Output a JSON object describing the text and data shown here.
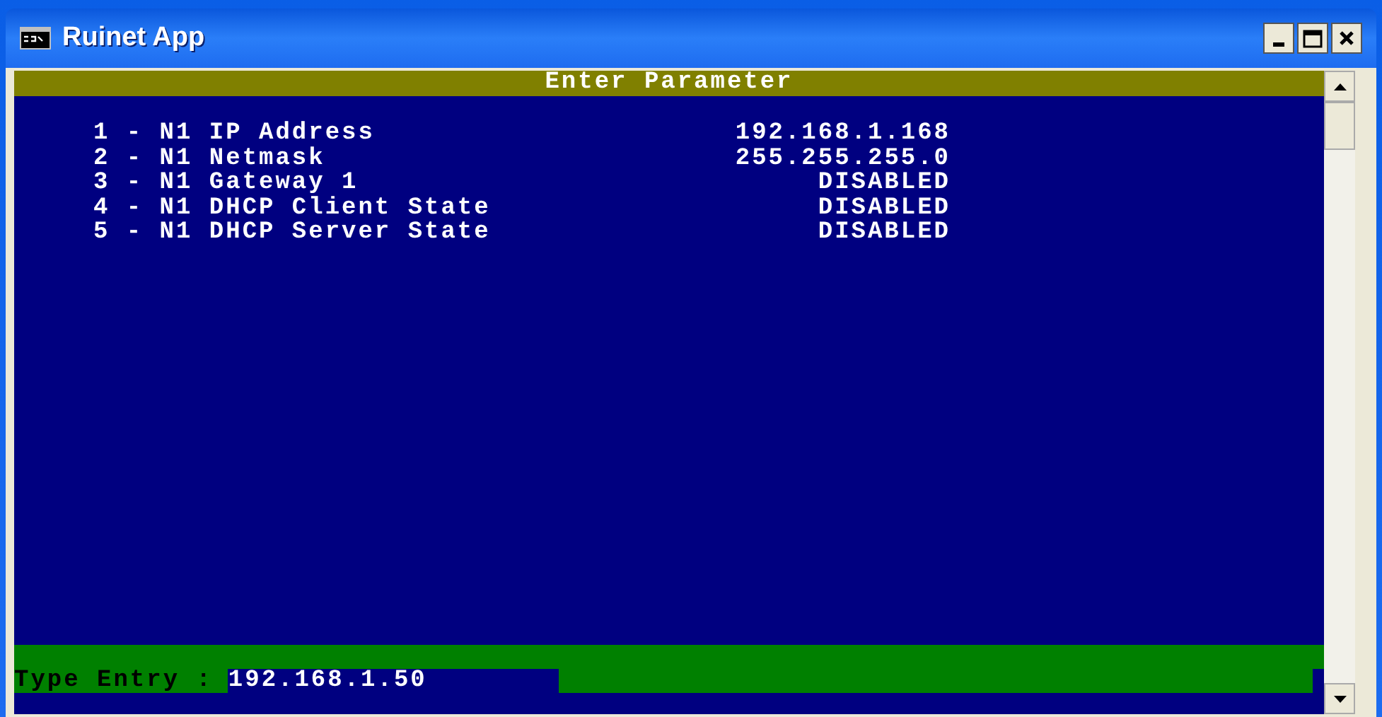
{
  "window": {
    "title": "Ruinet App"
  },
  "header": "Enter Parameter",
  "parameters": [
    {
      "label": "1 - N1 IP Address",
      "value": "192.168.1.168"
    },
    {
      "label": "2 - N1 Netmask",
      "value": "255.255.255.0"
    },
    {
      "label": "3 - N1 Gateway 1",
      "value": "DISABLED"
    },
    {
      "label": "4 - N1 DHCP Client State",
      "value": "DISABLED"
    },
    {
      "label": "5 - N1 DHCP Server State",
      "value": "DISABLED"
    }
  ],
  "entry": {
    "label": "Type Entry :",
    "value": "192.168.1.50"
  }
}
